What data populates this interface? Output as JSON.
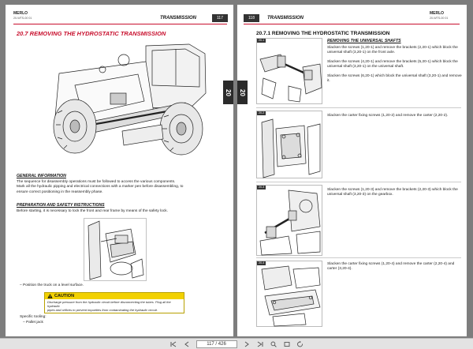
{
  "left_page": {
    "logo": "MERLO",
    "logo_sub": "20-WTS-00 01",
    "header_title": "TRANSMISSION",
    "page_number": "117",
    "side_tab": "20",
    "section_title": "20.7   REMOVING THE HYDROSTATIC TRANSMISSION",
    "general_info_head": "GENERAL INFORMATION",
    "general_info_lines": [
      "The sequence for disassembly operations must be followed to access the various components.",
      "Mark all the hydraulic pipping and electrical connections with a marker pen before disassembling, to",
      "ensure correct positioning in the reassembly phase."
    ],
    "prep_head": "PREPARATION AND SAFETY INSTRUCTIONS",
    "prep_text": "Before starting, it is necessary to lock the front and rear frame by means of the safety lock.",
    "position_text": "–   Position the truck on a level surface.",
    "caution_title": "CAUTION",
    "caution_lines": [
      "Discharge pressure from the hydraulic circuit before disconnecting the tubes. Plug all the hydraulic",
      "pipes and orifices to prevent impurities from contaminating the hydraulic circuit."
    ],
    "tooling_head": "Specific tooling:",
    "tooling_item": "–   Pallet jack"
  },
  "right_page": {
    "logo": "MERLO",
    "logo_sub": "20-WTS-00 01",
    "header_title": "TRANSMISSION",
    "page_number": "118",
    "side_tab": "20",
    "section_title": "20.7.1   REMOVING THE HYDROSTATIC TRANSMISSION",
    "sub_title": "REMOVING THE UNIVERSAL SHAFTS",
    "figures": [
      {
        "tag": "20-1",
        "paragraphs": [
          "Slacken the screws (1,20-1) and remove the brackets (2,20-1) which block the universal shaft (3,20-1) on the front axle.",
          "Slacken the screws (4,20-1) and remove the brackets (5,20-1) which block the universal shaft (3,20-1) on the universal shaft.",
          "Slacken the screws (6,20-1) which block the universal shaft (3,20-1) and remove it."
        ]
      },
      {
        "tag": "20-2",
        "paragraphs": [
          "Slacken the carter fixing screws (1,20-2) and remove the carter (2,20-2)."
        ]
      },
      {
        "tag": "20-3",
        "paragraphs": [
          "Slacken the screws (1,20-3) and remove the brackets (2,20-3) which block the universal shaft (3,20-3) on the gearbox."
        ]
      },
      {
        "tag": "20-4",
        "paragraphs": [
          "Slacken the carter fixing screws (1,20-4) and remove the carter (2,20-4) and carter (3,20-4)."
        ]
      }
    ]
  },
  "toolbar": {
    "page_value": "117 / 426"
  },
  "colors": {
    "accent_red": "#c8102e",
    "caution_yellow": "#f2d100"
  }
}
